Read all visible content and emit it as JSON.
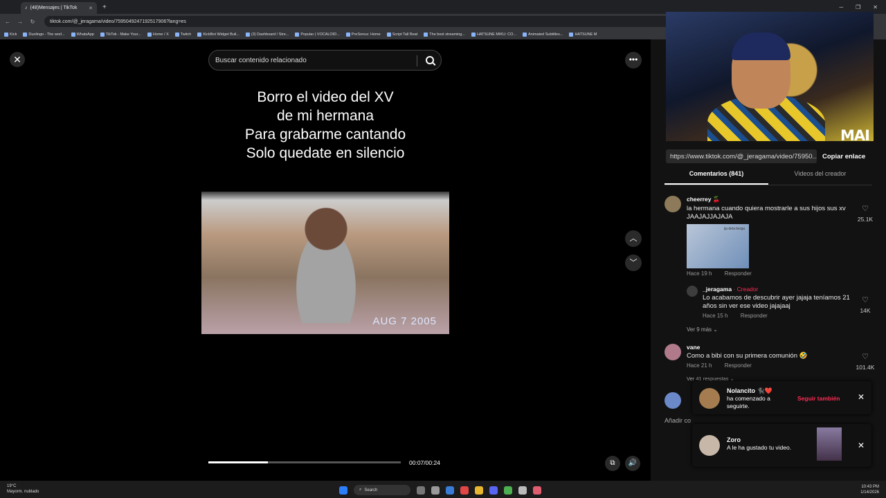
{
  "browser": {
    "tab_title": "(48)Mensajes | TikTok",
    "url": "tiktok.com/@_jeragama/video/7595049247192517906?lang=es",
    "bookmarks": [
      "Kick",
      "Duolingo - The worl...",
      "WhatsApp",
      "TikTok - Make Your...",
      "Home / X",
      "Twitch",
      "KickBot Widget Buil...",
      "(3) Dashboard / Stre...",
      "Popular | VOCALOID...",
      "PreSonus: Home",
      "Script Tall Beat",
      "The best streaming...",
      "HATSUNE MIKU: CO...",
      "Animated Subtitles...",
      "HATSUNE M"
    ]
  },
  "player": {
    "search_placeholder": "Buscar contenido relacionado",
    "caption_lines": [
      "Borro el video del XV",
      "de mi hermana",
      "Para grabarme cantando",
      "Solo quedate en silencio"
    ],
    "clip_date": "AUG  7 2005",
    "time": "00:07/00:24",
    "progress": 0.31
  },
  "webcam": {
    "tag": "MAI"
  },
  "panel": {
    "link": "https://www.tiktok.com/@_jeragama/video/75950...",
    "copy_label": "Copiar enlace",
    "tab_comments": "Comentarios (841)",
    "tab_creator": "Videos del creador",
    "add_comment": "Añadir co"
  },
  "comments": [
    {
      "user": "cheerrey 🍒",
      "text": "la hermana cuando quiera mostrarle a sus hijos sus xv JAAJAJJAJAJA",
      "time": "Hace 19 h",
      "reply": "Responder",
      "likes": "25.1K",
      "sticker_text": "ija dela berga"
    },
    {
      "user": "_jeragama",
      "badge": "· Creador",
      "text": "Lo acabamos de descubrir ayer jajaja teníamos 21 años sin ver ese video jajajaaj",
      "time": "Hace 15 h",
      "reply": "Responder",
      "likes": "14K"
    },
    {
      "more": "Ver 9 más ⌄"
    },
    {
      "user": "vane",
      "text": "Como a bibi con su primera comunión 🤣",
      "time": "Hace 21 h",
      "reply": "Responder",
      "likes": "101.4K"
    },
    {
      "more": "Ver 41 respuestas ⌄"
    }
  ],
  "notifications": [
    {
      "name": "Nolancito 🐈‍⬛❤️",
      "text1": "ha comenzado a",
      "text2": "seguirte.",
      "action": "Seguir también"
    },
    {
      "name": "Zoro",
      "text1": "A le ha gustado tu video."
    }
  ],
  "taskbar": {
    "temp": "19°C",
    "weather": "Mayorm. nublado",
    "search": "Search",
    "time": "10:43 PM",
    "date": "1/14/2026"
  }
}
